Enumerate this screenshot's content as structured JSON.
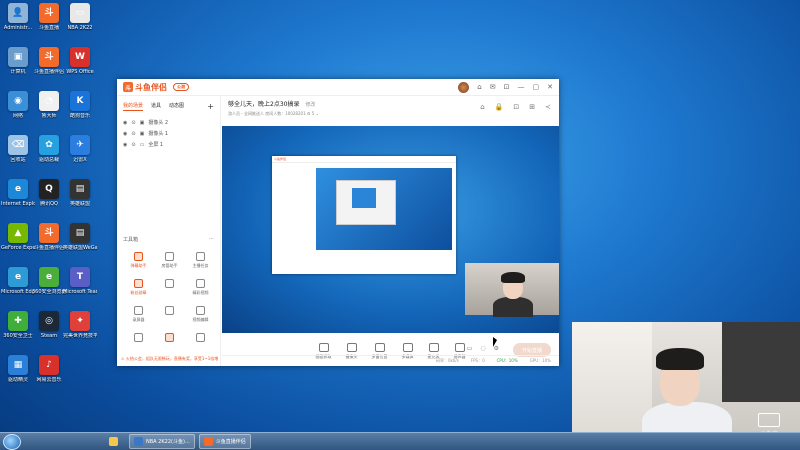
{
  "desktop": {
    "icons": [
      {
        "label": "Administr...",
        "color": "#8fb4d8",
        "glyph": "👤"
      },
      {
        "label": "斗鱼直播",
        "color": "#f26a2c",
        "glyph": "斗"
      },
      {
        "label": "NBA 2K22",
        "color": "#e8e8e8",
        "glyph": "▭"
      },
      {
        "label": "计算机",
        "color": "#6a9ccc",
        "glyph": "▣"
      },
      {
        "label": "斗鱼直播伴侣",
        "color": "#f26a2c",
        "glyph": "斗"
      },
      {
        "label": "WPS Office",
        "color": "#d8312b",
        "glyph": "W"
      },
      {
        "label": "网络",
        "color": "#3b8fd6",
        "glyph": "◉"
      },
      {
        "label": "鲁大师",
        "color": "#f0f0f0",
        "glyph": "◔"
      },
      {
        "label": "酷狗音乐",
        "color": "#1a73d8",
        "glyph": "K"
      },
      {
        "label": "回收站",
        "color": "#9cc4e6",
        "glyph": "⌫"
      },
      {
        "label": "驱动总裁",
        "color": "#25a0e0",
        "glyph": "✿"
      },
      {
        "label": "迅雷X",
        "color": "#2c7de0",
        "glyph": "✈"
      },
      {
        "label": "Internet Explorer",
        "color": "#1e88d8",
        "glyph": "e"
      },
      {
        "label": "腾讯QQ",
        "color": "#222",
        "glyph": "Q"
      },
      {
        "label": "英雄联盟",
        "color": "#333",
        "glyph": "▤"
      },
      {
        "label": "GeForce Experience",
        "color": "#76b900",
        "glyph": "▲"
      },
      {
        "label": "斗鱼直播伴侣",
        "color": "#f26a2c",
        "glyph": "斗"
      },
      {
        "label": "英雄联盟WeGame版",
        "color": "#333",
        "glyph": "▤"
      },
      {
        "label": "Microsoft Edge",
        "color": "#2d9bd6",
        "glyph": "e"
      },
      {
        "label": "360安全浏览器",
        "color": "#4cae3a",
        "glyph": "e"
      },
      {
        "label": "Microsoft Teams",
        "color": "#5a5fc7",
        "glyph": "T"
      },
      {
        "label": "360安全卫士",
        "color": "#3fae3a",
        "glyph": "✚"
      },
      {
        "label": "Steam",
        "color": "#1b2838",
        "glyph": "◎"
      },
      {
        "label": "完美世界竞技平台",
        "color": "#e0403a",
        "glyph": "✦"
      },
      {
        "label": "驱动精灵",
        "color": "#2a7fd8",
        "glyph": "▦"
      },
      {
        "label": "网易云音乐",
        "color": "#d8302a",
        "glyph": "♪"
      }
    ]
  },
  "taskbar": {
    "items": [
      {
        "label": "",
        "color": "#f5c84c"
      },
      {
        "label": "NBA 2K22(斗鱼)...",
        "color": "#3a78c6"
      },
      {
        "label": "斗鱼直播伴侣",
        "color": "#f26a2c"
      }
    ]
  },
  "app": {
    "logo": "斗鱼伴侣",
    "version": "公测",
    "title_icons": [
      "⌂",
      "✉",
      "⊡",
      "—",
      "▢",
      "✕"
    ],
    "tabs": [
      "我的场景",
      "道具",
      "动态图"
    ],
    "add_icon": "+",
    "scenes": [
      "摄像头 2",
      "摄像头 1",
      "全屏 1"
    ],
    "tools_header": "工具箱",
    "tools_more": "⋯",
    "tools": [
      {
        "label": "弹幕助手",
        "hot": true
      },
      {
        "label": "房管助手",
        "hot": false
      },
      {
        "label": "主播任务",
        "hot": false
      },
      {
        "label": "粉丝勋章",
        "hot": true
      },
      {
        "label": "",
        "hot": false
      },
      {
        "label": "精彩视频",
        "hot": false
      },
      {
        "label": "录屏器",
        "hot": false
      },
      {
        "label": "",
        "hot": false
      },
      {
        "label": "视频编辑",
        "hot": false
      },
      {
        "label": "",
        "hot": false
      },
      {
        "label": "",
        "hot": true
      },
      {
        "label": "",
        "hot": false
      }
    ],
    "notice": "⚠ 火热公会，组队无限畅玩，直播有奖，享受1~1倍增",
    "room": {
      "title": "够全儿天，晚上2点30搞录",
      "edit": "修改",
      "subtitle": "游人员 - 全网推送人    房间人数：10028201  ⚙ 5 ⌄"
    },
    "room_icons": [
      "⌂",
      "🔒",
      "⊡",
      "⊞",
      "≺"
    ],
    "controls": [
      {
        "label": "画面抓取"
      },
      {
        "label": "摄像头"
      },
      {
        "label": "多窗位置"
      },
      {
        "label": "多媒体"
      },
      {
        "label": "麦克风"
      },
      {
        "label": "扬声器"
      }
    ],
    "extra_icons": [
      "▭",
      "◌",
      "⚙"
    ],
    "golive": "开始直播",
    "status": {
      "item1": "码率：0kb/s",
      "item2": "FPS：0",
      "item3": "CPU：10%",
      "item4": "GPU：10%"
    }
  },
  "webcam": {
    "room_label": "斗鱼房",
    "room_number": "10028201"
  }
}
